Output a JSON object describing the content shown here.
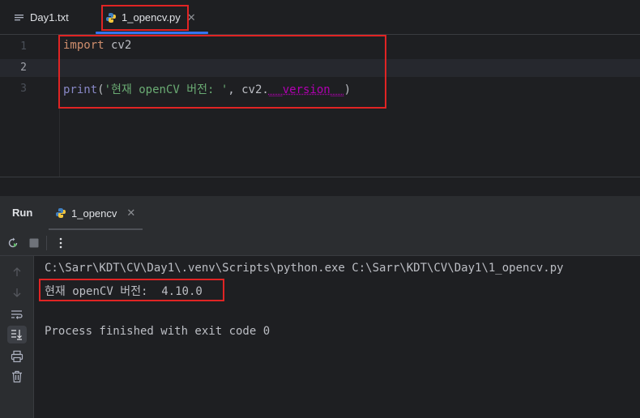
{
  "tabs": [
    {
      "label": "Day1.txt",
      "icon": "text-file-icon",
      "active": false
    },
    {
      "label": "1_opencv.py",
      "icon": "python-icon",
      "active": true
    }
  ],
  "editor": {
    "line_numbers": [
      "1",
      "2",
      "3"
    ],
    "line1": {
      "kw": "import",
      "rest": " cv2"
    },
    "line3": {
      "fn": "print",
      "open": "(",
      "str": "'현재 openCV 버전: '",
      "mid": ", cv2.",
      "dunder": "__version__",
      "close": ")"
    }
  },
  "run_panel": {
    "title": "Run",
    "tab_label": "1_opencv",
    "console": [
      "C:\\Sarr\\KDT\\CV\\Day1\\.venv\\Scripts\\python.exe C:\\Sarr\\KDT\\CV\\Day1\\1_opencv.py",
      "현재 openCV 버전:  4.10.0",
      "",
      "Process finished with exit code 0"
    ]
  },
  "colors": {
    "accent": "#3574f0",
    "highlight_box": "#e02424",
    "keyword": "#cf8e6d",
    "string": "#6aab73",
    "dunder": "#b200b2"
  }
}
